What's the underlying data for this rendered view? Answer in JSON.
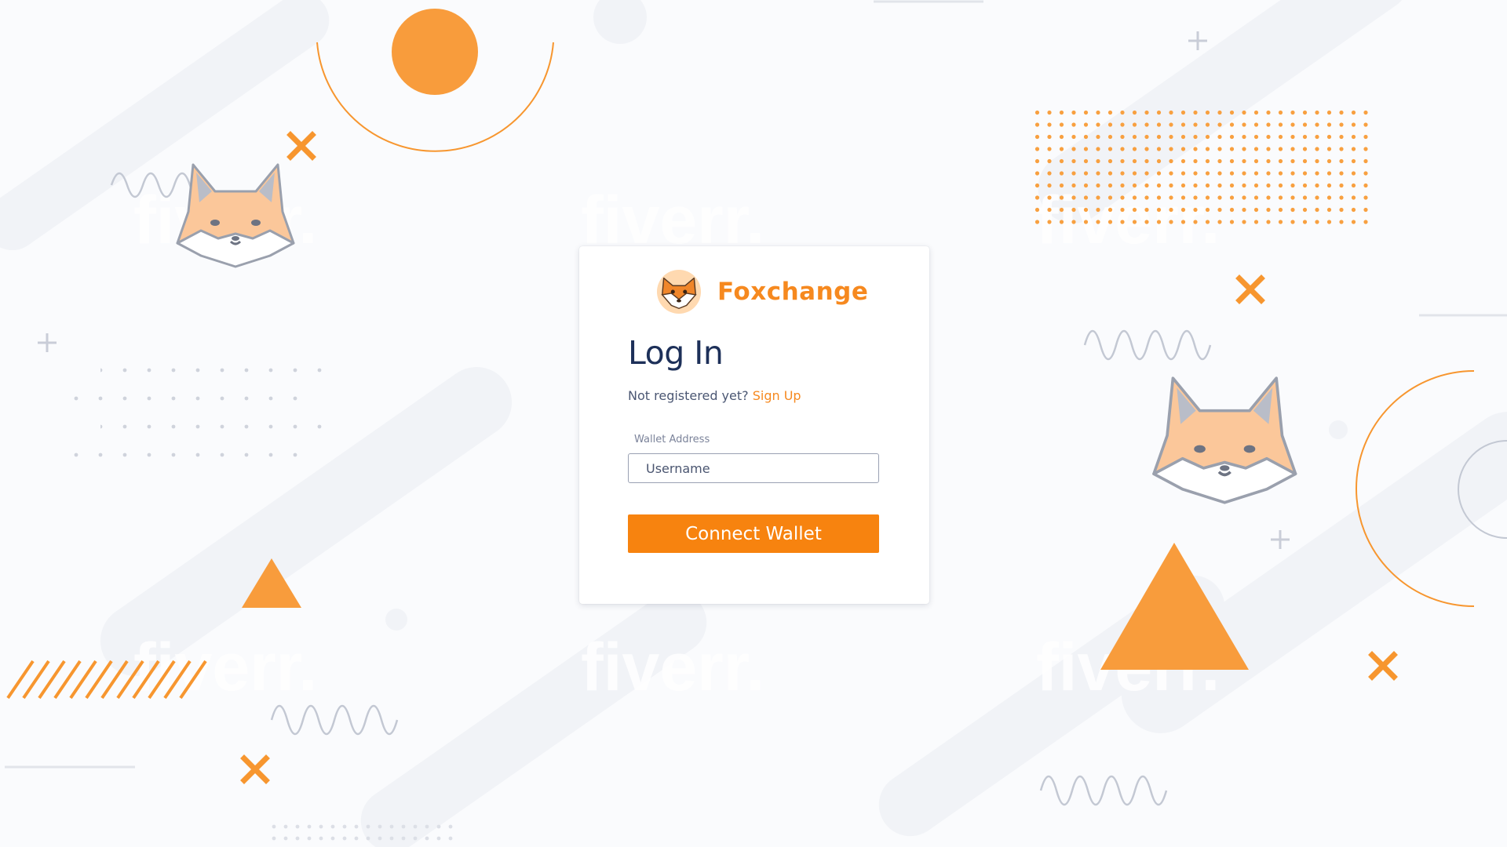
{
  "brand": {
    "name": "Foxchange",
    "logo_icon": "fox-head-icon"
  },
  "login": {
    "title": "Log In",
    "register_prompt": "Not registered yet?",
    "signup_link": "Sign Up",
    "wallet_label": "Wallet Address",
    "wallet_placeholder": "Username",
    "wallet_value": "",
    "connect_button": "Connect Wallet"
  },
  "background": {
    "watermark_text": "fiverr."
  },
  "colors": {
    "accent": "#f6891f",
    "title": "#1d3059",
    "button": "#f7830f",
    "page_bg": "#fafbfd"
  }
}
